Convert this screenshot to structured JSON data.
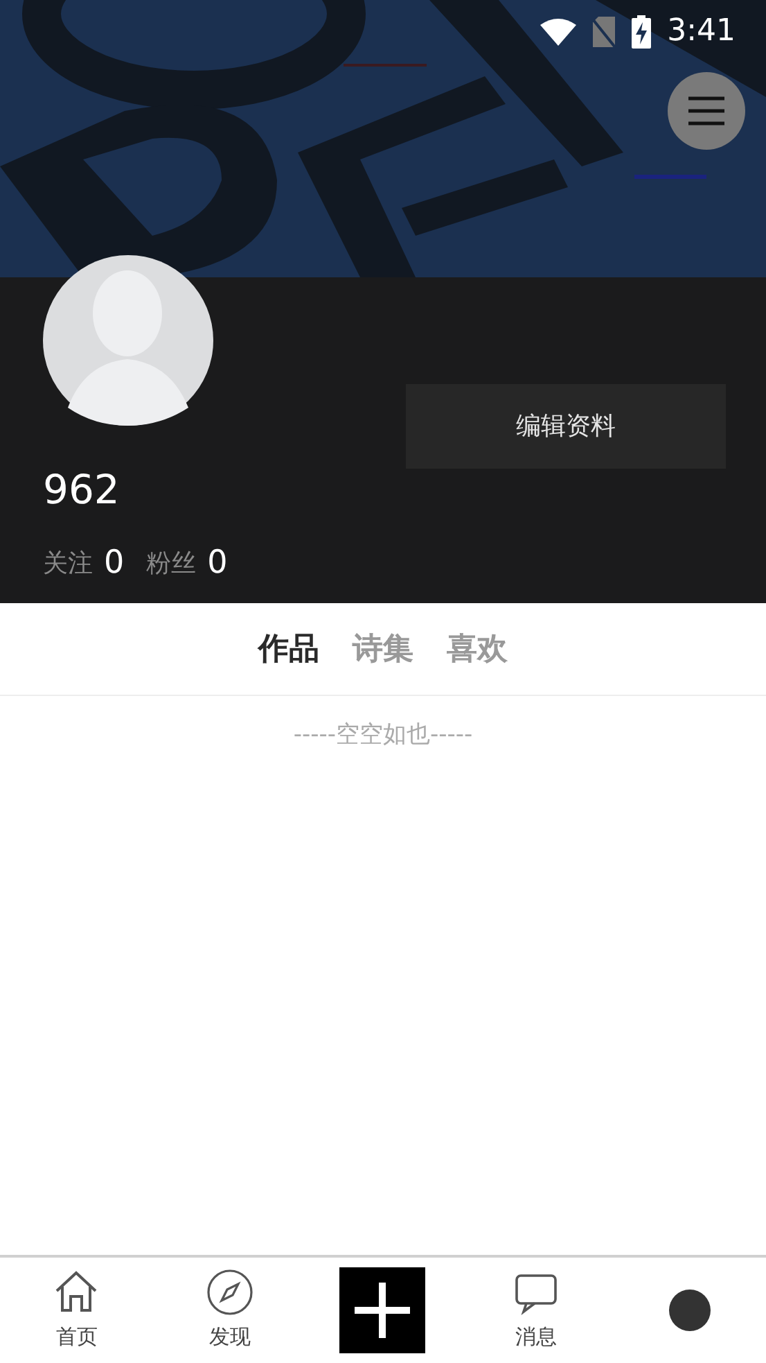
{
  "status_bar": {
    "time": "3:41"
  },
  "profile": {
    "name": "962",
    "edit_button": "编辑资料",
    "stats": [
      {
        "label": "关注",
        "value": "0"
      },
      {
        "label": "粉丝",
        "value": "0"
      }
    ]
  },
  "tabs": [
    {
      "label": "作品",
      "selected": true
    },
    {
      "label": "诗集",
      "selected": false
    },
    {
      "label": "喜欢",
      "selected": false
    }
  ],
  "empty_message": "-----空空如也-----",
  "bottom_nav": [
    {
      "kind": "home",
      "label": "首页"
    },
    {
      "kind": "discover",
      "label": "发现"
    },
    {
      "kind": "add"
    },
    {
      "kind": "messages",
      "label": "消息"
    },
    {
      "kind": "me"
    }
  ]
}
